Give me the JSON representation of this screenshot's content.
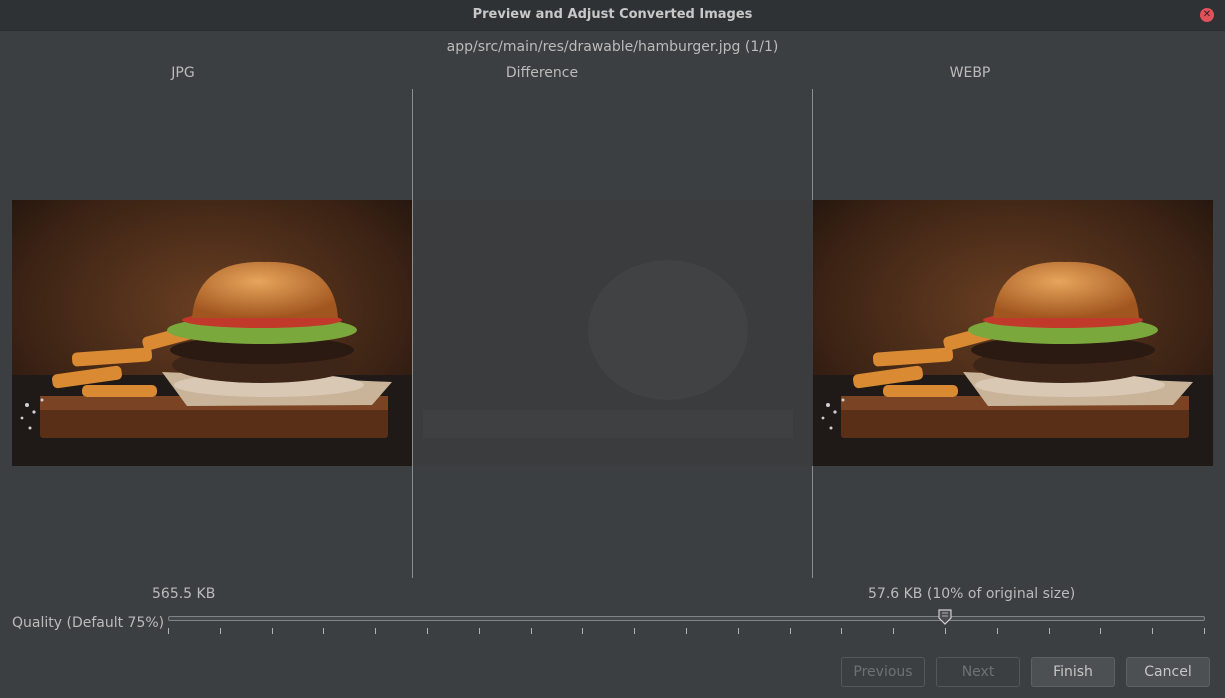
{
  "window": {
    "title": "Preview and Adjust Converted Images",
    "close_icon": "close-icon"
  },
  "file_path": "app/src/main/res/drawable/hamburger.jpg (1/1)",
  "columns": {
    "jpg_label": "JPG",
    "difference_label": "Difference",
    "webp_label": "WEBP"
  },
  "sizes": {
    "original": "565.5 KB",
    "converted": "57.6 KB (10% of original size)"
  },
  "quality": {
    "label": "Quality (Default 75%)",
    "value_percent": 75,
    "tick_count": 21
  },
  "buttons": {
    "previous": "Previous",
    "next": "Next",
    "finish": "Finish",
    "cancel": "Cancel"
  },
  "colors": {
    "background": "#3c3f41",
    "close_button": "#e0525a"
  }
}
